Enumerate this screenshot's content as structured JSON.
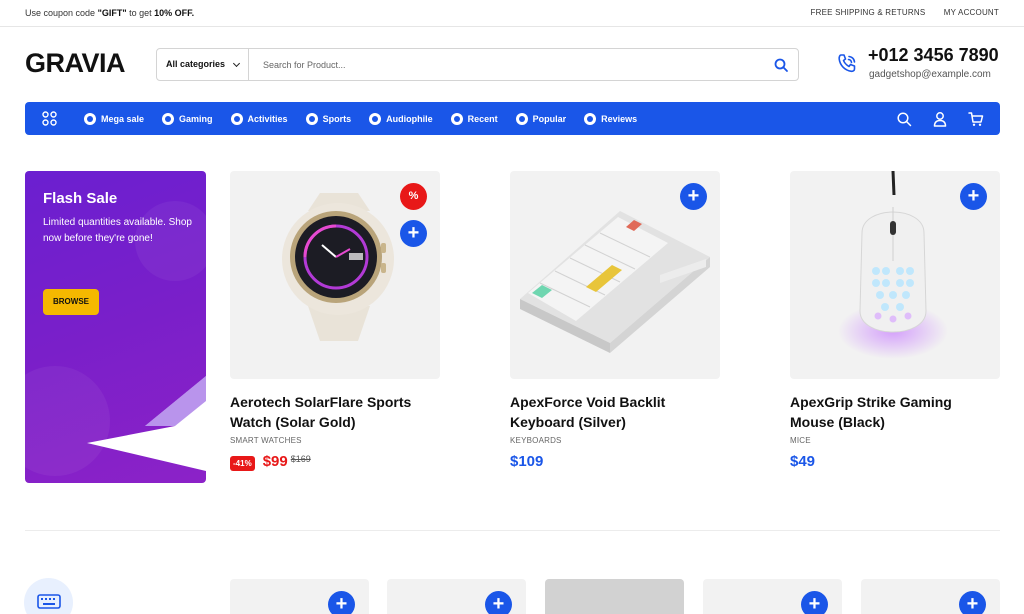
{
  "topbar": {
    "promo_prefix": "Use coupon code ",
    "promo_code": "\"GIFT\"",
    "promo_middle": " to get ",
    "promo_discount": "10% OFF.",
    "links": [
      "FREE SHIPPING & RETURNS",
      "MY ACCOUNT"
    ]
  },
  "header": {
    "logo": "GRAVIA",
    "category_select": "All categories",
    "search_placeholder": "Search for Product...",
    "phone": "+012 3456 7890",
    "email": "gadgetshop@example.com"
  },
  "nav": {
    "items": [
      "Mega sale",
      "Gaming",
      "Activities",
      "Sports",
      "Audiophile",
      "Recent",
      "Popular",
      "Reviews"
    ],
    "icons": [
      "search-icon",
      "user-icon",
      "cart-icon"
    ],
    "accent": "#1a56e8"
  },
  "flash_sale": {
    "title": "Flash Sale",
    "text": "Limited quantities available. Shop now before they're gone!",
    "button": "BROWSE"
  },
  "products": [
    {
      "title": "Aerotech SolarFlare Sports Watch (Solar Gold)",
      "category": "SMART WATCHES",
      "discount": "-41%",
      "price": "$99",
      "old_price": "$169",
      "badge": "%"
    },
    {
      "title": "ApexForce Void Backlit Keyboard (Silver)",
      "category": "KEYBOARDS",
      "price": "$109"
    },
    {
      "title": "ApexGrip Strike Gaming Mouse (Black)",
      "category": "MICE",
      "price": "$49"
    }
  ],
  "add_label": "+"
}
